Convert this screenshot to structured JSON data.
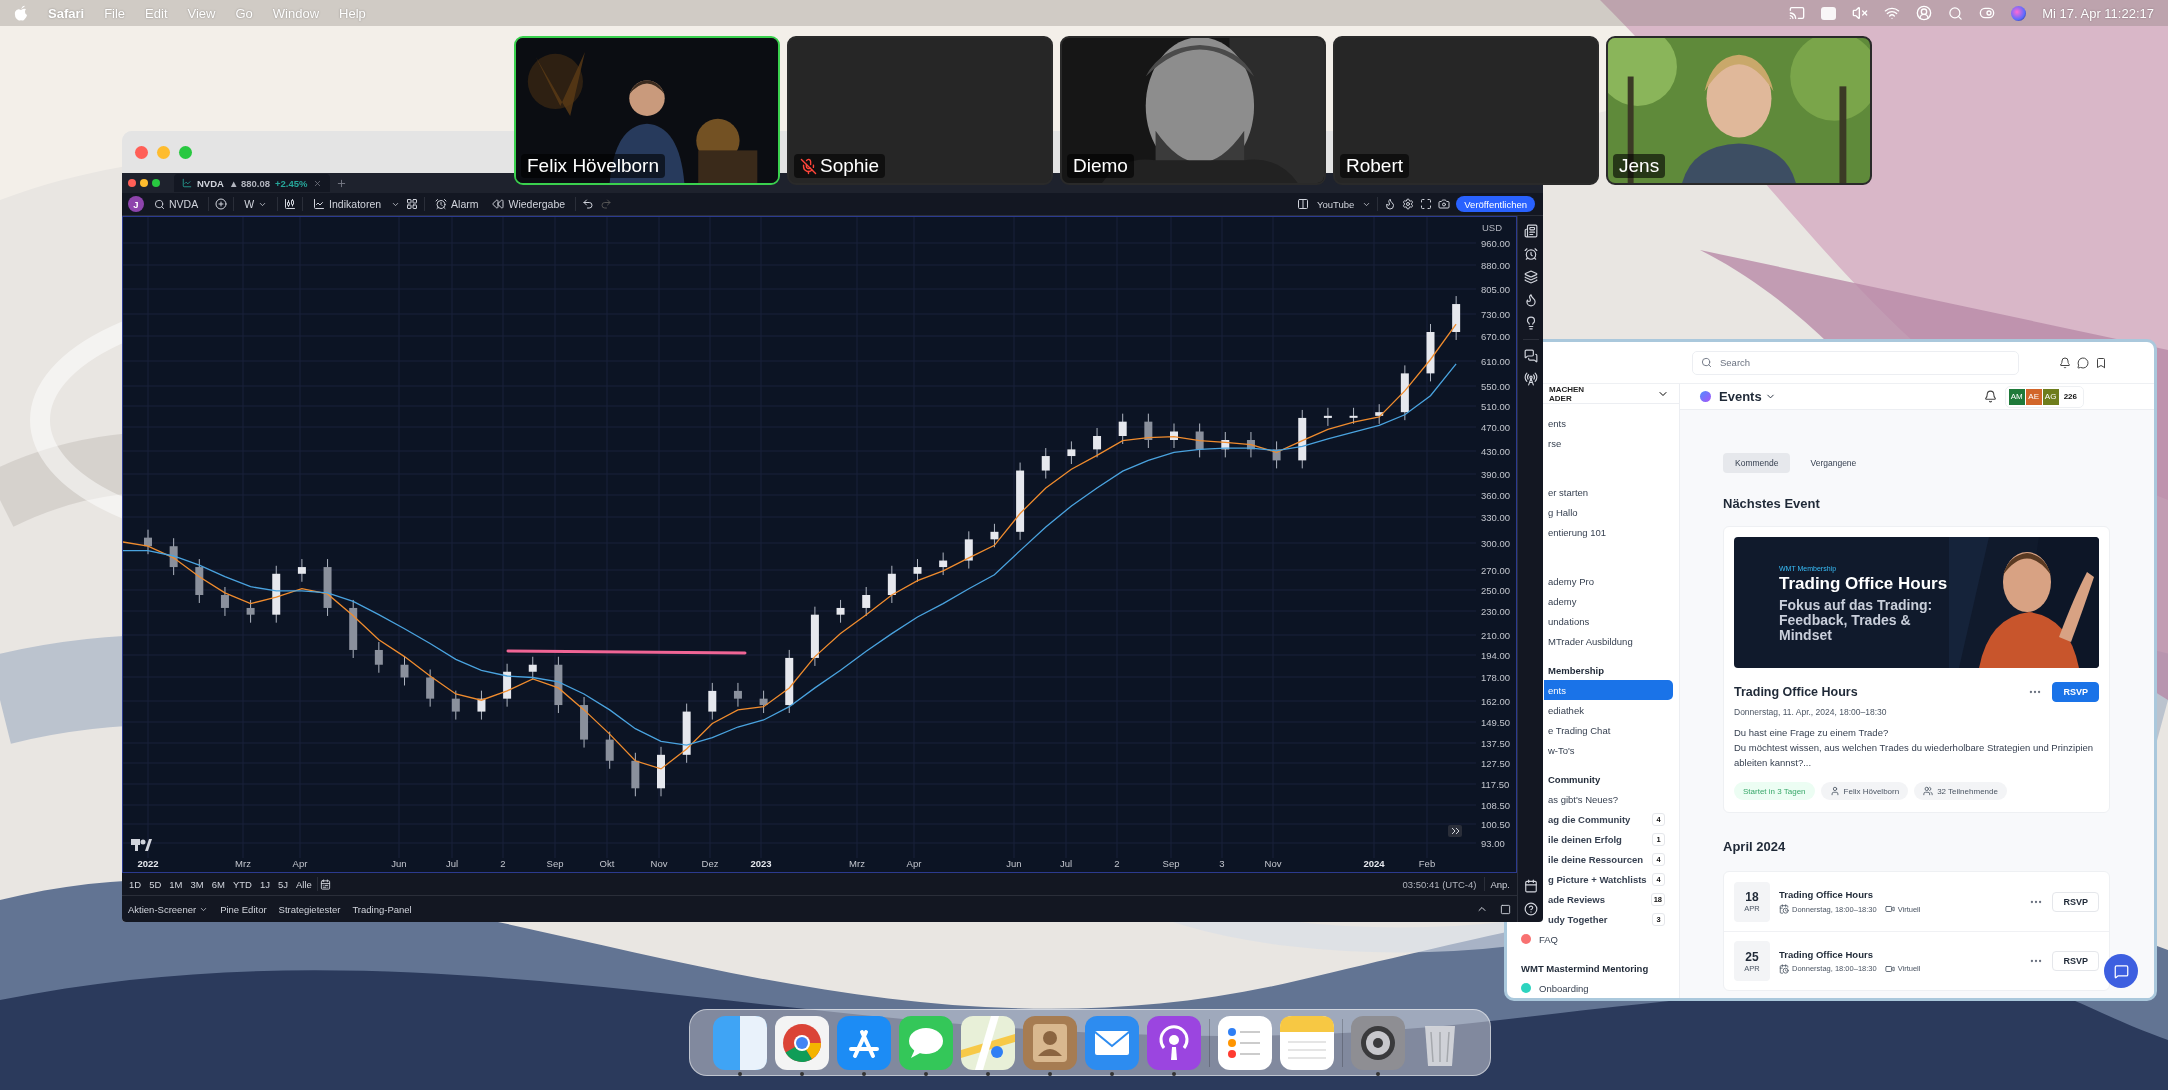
{
  "menu_bar": {
    "app": "Safari",
    "items": [
      "File",
      "Edit",
      "View",
      "Go",
      "Window",
      "Help"
    ],
    "clock": "Mi 17. Apr 11:22:17"
  },
  "video_tiles": [
    {
      "name": "Felix Hövelborn",
      "kind": "video",
      "speaking": true,
      "muted": false
    },
    {
      "name": "Sophie",
      "kind": "off",
      "speaking": false,
      "muted": true
    },
    {
      "name": "Diemo",
      "kind": "video",
      "speaking": false,
      "muted": false
    },
    {
      "name": "Robert",
      "kind": "off",
      "speaking": false,
      "muted": false
    },
    {
      "name": "Jens",
      "kind": "video",
      "speaking": false,
      "muted": false
    }
  ],
  "trading_window": {
    "tab": {
      "symbol": "NVDA",
      "price": "▲ 880.08",
      "change": "+2.45%"
    },
    "toolbar": {
      "avatar": "J",
      "symbol": "NVDA",
      "interval": "W",
      "indicators": "Indikatoren",
      "alarm": "Alarm",
      "replay": "Wiedergabe",
      "layout_name": "YouTube",
      "publish": "Veröffentlichen"
    },
    "price_axis": {
      "currency": "USD",
      "labels": [
        "960.00",
        "880.00",
        "805.00",
        "730.00",
        "670.00",
        "610.00",
        "550.00",
        "510.00",
        "470.00",
        "430.00",
        "390.00",
        "360.00",
        "330.00",
        "300.00",
        "270.00",
        "250.00",
        "230.00",
        "210.00",
        "194.00",
        "178.00",
        "162.00",
        "149.50",
        "137.50",
        "127.50",
        "117.50",
        "108.50",
        "100.50",
        "93.00"
      ]
    },
    "time_axis": [
      {
        "label": "2022",
        "kind": "year"
      },
      {
        "label": "Mrz",
        "kind": "month"
      },
      {
        "label": "Apr",
        "kind": "month"
      },
      {
        "label": "Jun",
        "kind": "month"
      },
      {
        "label": "Jul",
        "kind": "month"
      },
      {
        "label": "2",
        "kind": "month"
      },
      {
        "label": "Sep",
        "kind": "month"
      },
      {
        "label": "Okt",
        "kind": "month"
      },
      {
        "label": "Nov",
        "kind": "month"
      },
      {
        "label": "Dez",
        "kind": "month"
      },
      {
        "label": "2023",
        "kind": "year"
      },
      {
        "label": "Mrz",
        "kind": "month"
      },
      {
        "label": "Apr",
        "kind": "month"
      },
      {
        "label": "Jun",
        "kind": "month"
      },
      {
        "label": "Jul",
        "kind": "month"
      },
      {
        "label": "2",
        "kind": "month"
      },
      {
        "label": "Sep",
        "kind": "month"
      },
      {
        "label": "3",
        "kind": "month"
      },
      {
        "label": "Nov",
        "kind": "month"
      },
      {
        "label": "2024",
        "kind": "year"
      },
      {
        "label": "Feb",
        "kind": "month"
      }
    ],
    "ranges": [
      "1D",
      "5D",
      "1M",
      "3M",
      "6M",
      "YTD",
      "1J",
      "5J",
      "Alle"
    ],
    "clock": "03:50:41 (UTC-4)",
    "adjust": "Anp.",
    "panels": [
      "Aktien-Screener",
      "Pine Editor",
      "Strategietester",
      "Trading-Panel"
    ]
  },
  "community_window": {
    "search": {
      "placeholder": "Search"
    },
    "logo_lines": [
      "MACHEN",
      "ADER"
    ],
    "sidebar": {
      "groups": [
        {
          "items": [
            {
              "label": "ents",
              "selected": false
            },
            {
              "label": "rse",
              "selected": false
            }
          ]
        },
        {
          "items": [
            {
              "label": "er starten",
              "selected": false
            },
            {
              "label": "g Hallo",
              "selected": false
            },
            {
              "label": "entierung 101",
              "selected": false
            }
          ]
        },
        {
          "items": [
            {
              "label": "ademy Pro",
              "selected": false
            },
            {
              "label": "ademy",
              "selected": false
            },
            {
              "label": "undations",
              "selected": false
            },
            {
              "label": "MTrader Ausbildung",
              "selected": false
            }
          ]
        },
        {
          "heading": "Membership",
          "items": [
            {
              "label": "ents",
              "selected": true
            },
            {
              "label": "ediathek",
              "selected": false
            },
            {
              "label": "e Trading Chat",
              "selected": false
            },
            {
              "label": "w-To's",
              "selected": false
            }
          ]
        },
        {
          "heading": "Community",
          "items": [
            {
              "label": "as gibt's Neues?",
              "selected": false
            },
            {
              "label": "ag die Community",
              "count": "4",
              "selected": false
            },
            {
              "label": "ile deinen Erfolg",
              "count": "1",
              "selected": false
            },
            {
              "label": "ile deine Ressourcen",
              "count": "4",
              "selected": false
            },
            {
              "label": "g Picture + Watchlists",
              "count": "4",
              "selected": false
            },
            {
              "label": "ade Reviews",
              "count": "18",
              "selected": false
            },
            {
              "label": "udy Together",
              "count": "3",
              "selected": false
            },
            {
              "label": "FAQ",
              "color": "#f87171",
              "selected": false
            }
          ]
        },
        {
          "heading": "WMT Mastermind Mentoring",
          "items": [
            {
              "label": "Onboarding",
              "color": "#2dd4bf",
              "selected": false
            }
          ]
        }
      ]
    },
    "page_title": "Events",
    "members": [
      {
        "initials": "AM",
        "color": "#1f7a3a"
      },
      {
        "initials": "AE",
        "color": "#d2662a"
      },
      {
        "initials": "AG",
        "color": "#6e7d1c"
      }
    ],
    "member_count": "226",
    "tabs": [
      {
        "label": "Kommende",
        "selected": true
      },
      {
        "label": "Vergangene",
        "selected": false
      }
    ],
    "next_heading": "Nächstes Event",
    "featured": {
      "banner": {
        "eyebrow": "WMT Membership",
        "title": "Trading Office Hours",
        "subtitle": "Fokus auf das Trading: Feedback, Trades & Mindset"
      },
      "title": "Trading Office Hours",
      "rsvp": "RSVP",
      "date": "Donnerstag, 11. Apr., 2024, 18:00–18:30",
      "description": [
        "Du hast eine Frage zu einem Trade?",
        "Du möchtest wissen, aus welchen Trades du wiederholbare Strategien und Prinzipien ableiten kannst?..."
      ],
      "chips": [
        {
          "kind": "status",
          "label": "Startet in 3 Tagen"
        },
        {
          "kind": "host",
          "label": "Felix Hövelborn"
        },
        {
          "kind": "attendees",
          "label": "32 Teilnehmende"
        }
      ]
    },
    "month_heading": "April 2024",
    "events": [
      {
        "day": "18",
        "month": "APR",
        "title": "Trading Office Hours",
        "time": "Donnerstag, 18:00–18:30",
        "location": "Virtuell",
        "rsvp": "RSVP"
      },
      {
        "day": "25",
        "month": "APR",
        "title": "Trading Office Hours",
        "time": "Donnerstag, 18:00–18:30",
        "location": "Virtuell",
        "rsvp": "RSVP"
      }
    ]
  },
  "dock": {
    "items": [
      {
        "kind": "split",
        "running": true
      },
      {
        "kind": "ring",
        "running": true
      },
      {
        "kind": "triangle",
        "running": true
      },
      {
        "kind": "bubble",
        "running": true
      },
      {
        "kind": "map",
        "running": true
      },
      {
        "kind": "contact",
        "running": true
      },
      {
        "kind": "envelope",
        "running": true
      },
      {
        "kind": "broadcast",
        "running": true
      },
      {
        "kind": "checklist",
        "running": false
      },
      {
        "kind": "notepad",
        "running": false
      },
      {
        "kind": "gear",
        "running": true
      },
      {
        "kind": "trash",
        "running": false
      }
    ]
  }
}
